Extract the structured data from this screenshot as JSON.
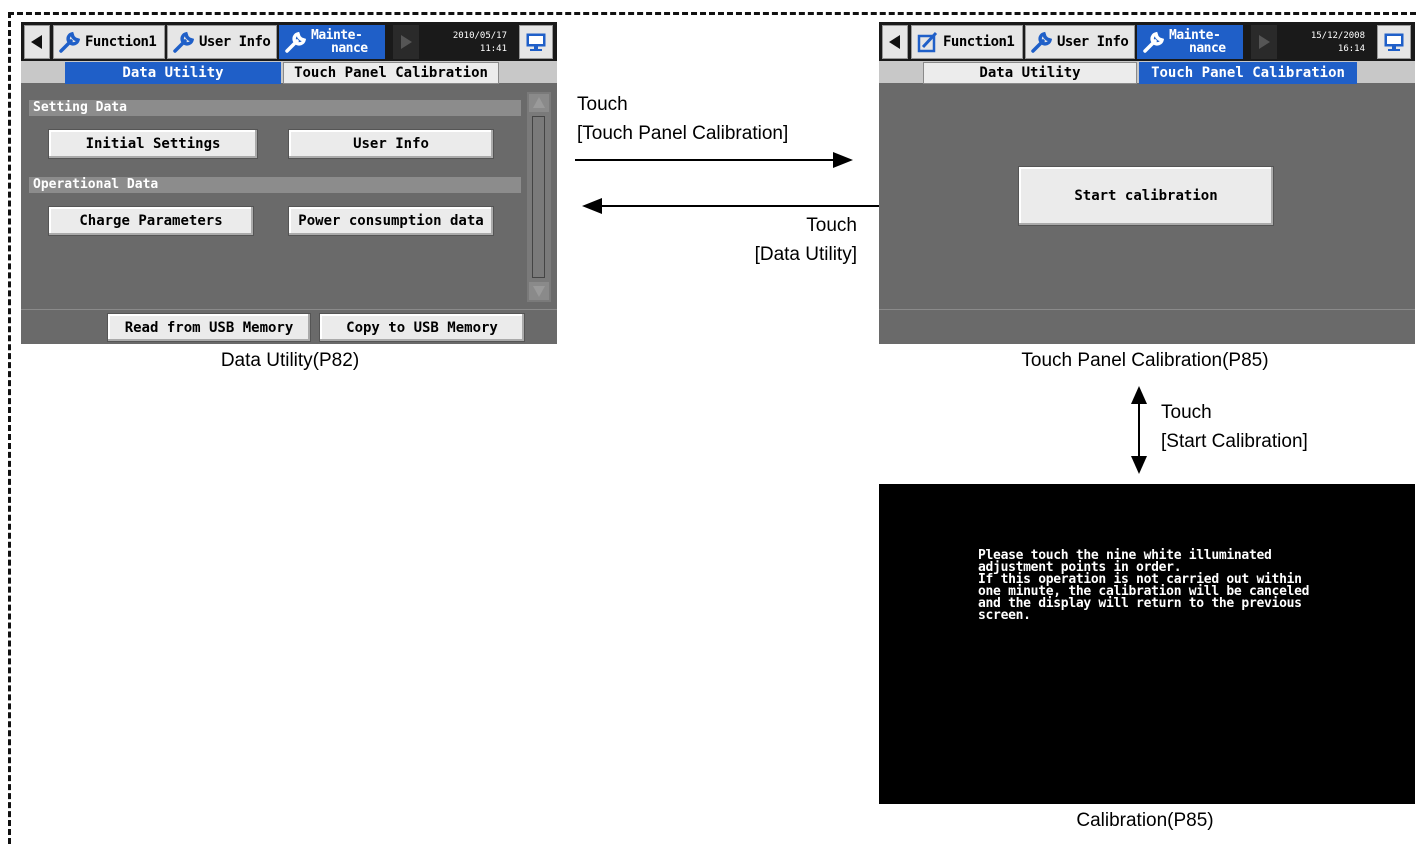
{
  "screen1": {
    "toolbar": {
      "function1": "Function1",
      "user_info": "User Info",
      "maintenance_line1": "Mainte-",
      "maintenance_line2": "nance",
      "date": "2010/05/17",
      "time": "11:41"
    },
    "tabs": {
      "data_utility": "Data Utility",
      "touch_panel_calibration": "Touch Panel Calibration"
    },
    "sections": {
      "setting_data": "Setting Data",
      "operational_data": "Operational Data"
    },
    "buttons": {
      "initial_settings": "Initial Settings",
      "user_info": "User Info",
      "charge_parameters": "Charge Parameters",
      "power_consumption": "Power consumption data",
      "read_usb": "Read from USB Memory",
      "copy_usb": "Copy to USB Memory"
    },
    "caption": "Data Utility(P82)"
  },
  "screen2": {
    "toolbar": {
      "function1": "Function1",
      "user_info": "User Info",
      "maintenance_line1": "Mainte-",
      "maintenance_line2": "nance",
      "date": "15/12/2008",
      "time": "16:14"
    },
    "tabs": {
      "data_utility": "Data Utility",
      "touch_panel_calibration": "Touch Panel Calibration"
    },
    "buttons": {
      "start_calibration": "Start calibration"
    },
    "caption": "Touch Panel Calibration(P85)"
  },
  "screen3": {
    "message": "Please touch the nine white illuminated\nadjustment points in order.\nIf this operation is not carried out within\none minute, the calibration will be canceled\nand the display will return to the previous\nscreen.",
    "caption": "Calibration(P85)"
  },
  "arrows": {
    "to_calibration_line1": "Touch",
    "to_calibration_line2": "[Touch Panel Calibration]",
    "to_data_utility_line1": "Touch",
    "to_data_utility_line2": "[Data Utility]",
    "start_line1": "Touch",
    "start_line2": "[Start Calibration]"
  },
  "colors": {
    "active_tab": "#1f5fc8",
    "screen_bg": "#6a6a6a",
    "toolbar_bg": "#1a1a1a",
    "calibration_bg": "#000000"
  }
}
